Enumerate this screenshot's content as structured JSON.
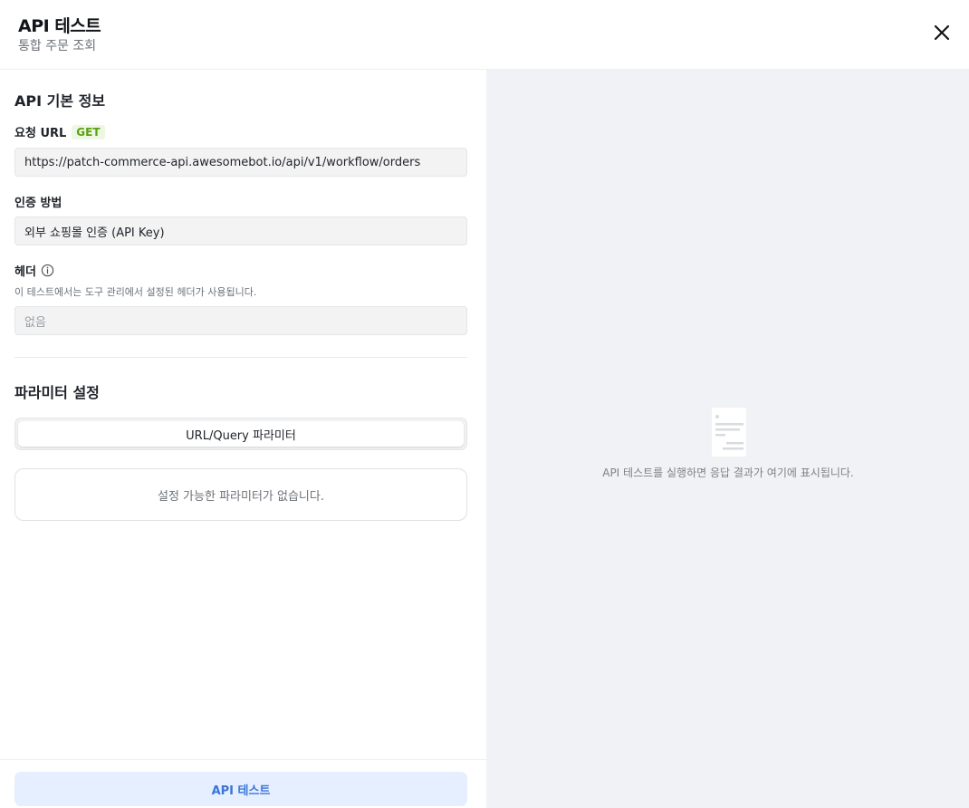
{
  "header": {
    "title": "API 테스트",
    "subtitle": "통합 주문 조회",
    "close_icon": "close-icon"
  },
  "basic_info": {
    "section_title": "API 기본 정보",
    "url_label": "요청 URL",
    "method": "GET",
    "url_value": "https://patch-commerce-api.awesomebot.io/api/v1/workflow/orders",
    "auth_label": "인증 방법",
    "auth_value": "외부 쇼핑몰 인증 (API Key)",
    "headers_label": "헤더",
    "headers_info_icon": "info-icon",
    "headers_helper": "이 테스트에서는 도구 관리에서 설정된 헤더가 사용됩니다.",
    "headers_value": "없음"
  },
  "params": {
    "section_title": "파라미터 설정",
    "tabs": [
      {
        "label": "URL/Query 파라미터",
        "active": true
      }
    ],
    "empty_message": "설정 가능한 파라미터가 없습니다."
  },
  "footer": {
    "test_button_label": "API 테스트"
  },
  "result_panel": {
    "icon": "document-icon",
    "empty_message": "API 테스트를 실행하면 응답 결과가 여기에 표시됩니다."
  },
  "colors": {
    "method_badge_text": "#59a10f",
    "method_badge_bg": "#eef7e3",
    "primary_button_bg": "#e5efff",
    "primary_button_text": "#3b74d9",
    "result_panel_bg": "#f1f2f5"
  }
}
